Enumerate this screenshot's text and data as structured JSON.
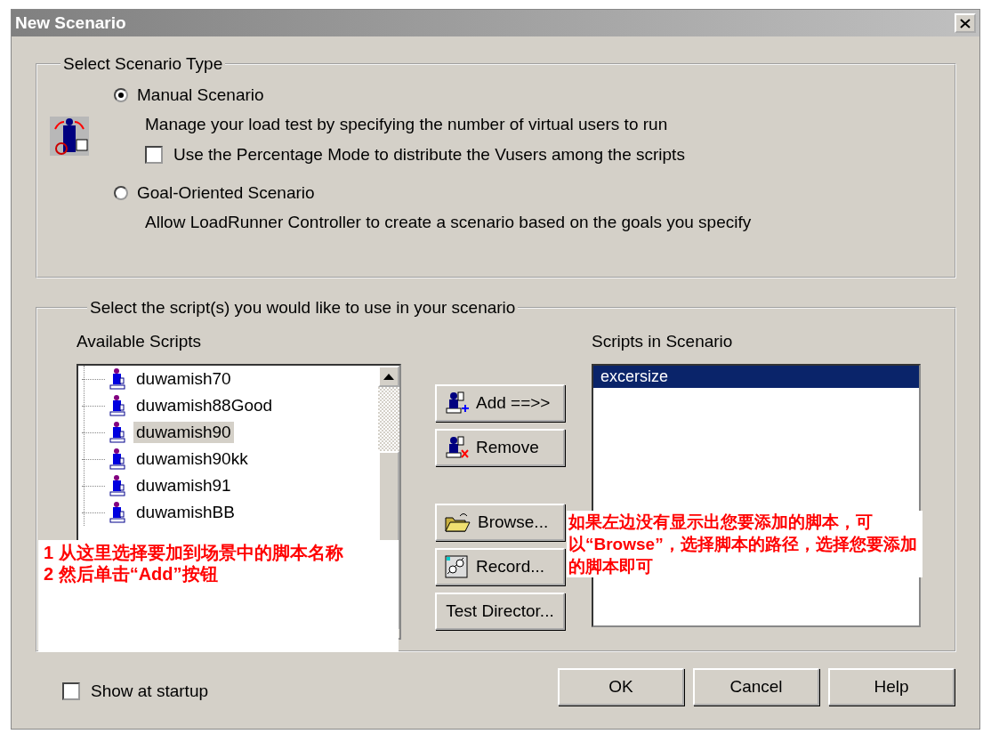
{
  "window": {
    "title": "New Scenario"
  },
  "scenario_type": {
    "legend": "Select Scenario Type",
    "options": [
      {
        "label": "Manual Scenario",
        "selected": true,
        "description": "Manage your load test by specifying the number of virtual users to run",
        "option": {
          "label": "Use the Percentage Mode to distribute the Vusers among the scripts",
          "checked": false
        }
      },
      {
        "label": "Goal-Oriented Scenario",
        "selected": false,
        "description": "Allow LoadRunner Controller to create a scenario based on the goals you specify"
      }
    ]
  },
  "scripts": {
    "legend": "Select the script(s) you would like to use in your scenario",
    "available": {
      "label": "Available Scripts",
      "items": [
        {
          "name": "duwamish70",
          "selected": false
        },
        {
          "name": "duwamish88Good",
          "selected": false
        },
        {
          "name": "duwamish90",
          "selected": true
        },
        {
          "name": "duwamish90kk",
          "selected": false
        },
        {
          "name": "duwamish91",
          "selected": false
        },
        {
          "name": "duwamishBB",
          "selected": false
        }
      ]
    },
    "actions": [
      {
        "kind": "add",
        "label": "Add ==>>"
      },
      {
        "kind": "remove",
        "label": "Remove"
      },
      {
        "kind": "browse",
        "label": "Browse..."
      },
      {
        "kind": "record",
        "label": "Record..."
      },
      {
        "kind": "plain",
        "label": "Test Director..."
      }
    ],
    "in_scenario": {
      "label": "Scripts in Scenario",
      "items": [
        {
          "name": "excersize",
          "selected": true
        }
      ]
    }
  },
  "annotations": {
    "left": [
      "1  从这里选择要加到场景中的脚本名称",
      "2  然后单击“Add”按钮"
    ],
    "right": "如果左边没有显示出您要添加的脚本，可以“Browse”，选择脚本的路径，选择您要添加的脚本即可"
  },
  "footer": {
    "show_at_startup": {
      "label": "Show at startup",
      "checked": false
    },
    "buttons": [
      "OK",
      "Cancel",
      "Help"
    ]
  }
}
